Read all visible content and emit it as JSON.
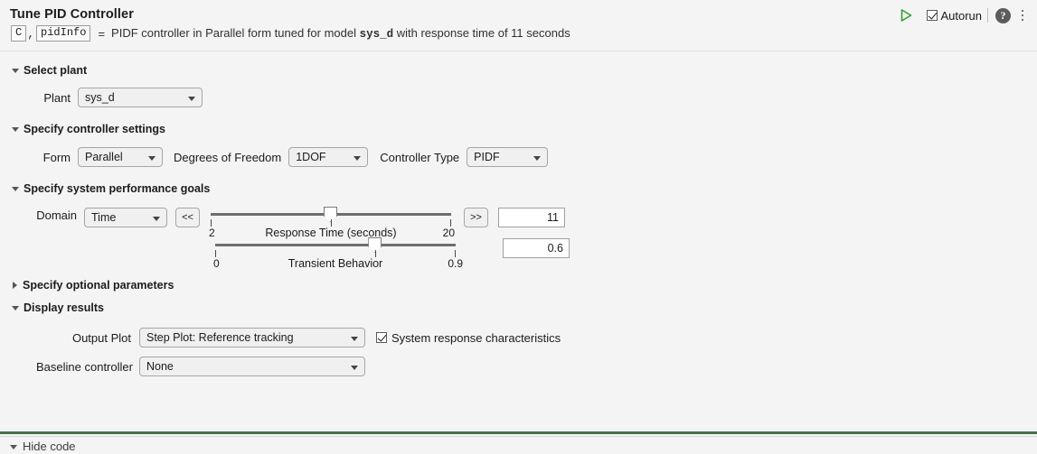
{
  "header": {
    "title": "Tune PID Controller",
    "outputs": [
      "C",
      "pidInfo"
    ],
    "separator": ",",
    "equals": "=",
    "summary_prefix": "PIDF controller in Parallel form tuned for model ",
    "summary_model": "sys_d",
    "summary_suffix": " with response time of 11 seconds",
    "run_icon": "run-triangle-icon",
    "autorun_label": "Autorun",
    "autorun_checked": true,
    "help_glyph": "?",
    "menu_icon": "kebab-menu-icon",
    "accent_green": "#46704c"
  },
  "sections": {
    "select_plant": {
      "title": "Select plant",
      "expanded": true,
      "plant_label": "Plant",
      "plant_value": "sys_d"
    },
    "controller_settings": {
      "title": "Specify controller settings",
      "expanded": true,
      "form_label": "Form",
      "form_value": "Parallel",
      "dof_label": "Degrees of Freedom",
      "dof_value": "1DOF",
      "type_label": "Controller Type",
      "type_value": "PIDF"
    },
    "performance_goals": {
      "title": "Specify system performance goals",
      "expanded": true,
      "domain_label": "Domain",
      "domain_value": "Time",
      "decrease_button": "<<",
      "increase_button": ">>",
      "response_time": {
        "label": "Response Time (seconds)",
        "min_label": "2",
        "max_label": "20",
        "min": 2,
        "max": 20,
        "value": 11,
        "value_text": "11",
        "handle_pct": 50
      },
      "transient_behavior": {
        "label": "Transient Behavior",
        "min_label": "0",
        "max_label": "0.9",
        "min": 0,
        "max": 0.9,
        "value": 0.6,
        "value_text": "0.6",
        "handle_pct": 66.7
      }
    },
    "optional_parameters": {
      "title": "Specify optional parameters",
      "expanded": false
    },
    "display_results": {
      "title": "Display results",
      "expanded": true,
      "output_plot_label": "Output Plot",
      "output_plot_value": "Step Plot: Reference tracking",
      "characteristics_label": "System response characteristics",
      "characteristics_checked": true,
      "baseline_label": "Baseline controller",
      "baseline_value": "None"
    }
  },
  "footer": {
    "hide_code_label": "Hide code"
  }
}
